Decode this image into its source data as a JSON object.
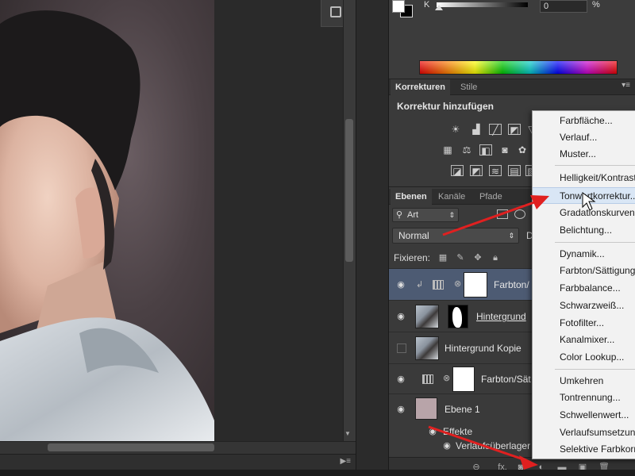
{
  "color_panel": {
    "channel_label": "K",
    "channel_value": "0",
    "percent_sign": "%",
    "foreground_color": "#ffffff",
    "background_color": "#000000"
  },
  "adjustments_panel": {
    "tabs": [
      {
        "label": "Korrekturen",
        "active": true
      },
      {
        "label": "Stile",
        "active": false
      }
    ],
    "title": "Korrektur hinzufügen",
    "icon_rows": [
      [
        "sun-icon",
        "levels-icon",
        "curves-icon",
        "exposure-icon",
        "triangle-icon"
      ],
      [
        "hue-saturation-icon",
        "color-balance-icon",
        "bw-icon",
        "photo-filter-icon",
        "channel-mixer-icon",
        "color-lookup-icon"
      ],
      [
        "invert-icon",
        "posterize-icon",
        "threshold-icon",
        "gradient-map-icon",
        "selective-color-icon"
      ]
    ]
  },
  "layers_panel": {
    "tabs": [
      {
        "label": "Ebenen",
        "active": true
      },
      {
        "label": "Kanäle",
        "active": false
      },
      {
        "label": "Pfade",
        "active": false
      }
    ],
    "filter_value": "Art",
    "blend_mode": "Normal",
    "opacity_label": "D",
    "lock_label": "Fixieren:",
    "layers": [
      {
        "name": "Farbton/",
        "visible": true,
        "selected": true,
        "type": "adjustment"
      },
      {
        "name": "Hintergrund",
        "visible": true,
        "selected": false,
        "type": "photo-mask"
      },
      {
        "name": "Hintergrund Kopie",
        "visible": false,
        "selected": false,
        "type": "photo"
      },
      {
        "name": "Farbton/Sät",
        "visible": true,
        "selected": false,
        "type": "adjustment"
      },
      {
        "name": "Ebene 1",
        "visible": true,
        "selected": false,
        "type": "fill"
      }
    ],
    "effects_label": "Effekte",
    "effect_item": "Verlaufsüberlager",
    "footer_fx": "fx."
  },
  "adjustment_menu": {
    "items": [
      "Farbfläche...",
      "Verlauf...",
      "Muster...",
      "Helligkeit/Kontrast...",
      "Tonwertkorrektur...",
      "Gradationskurven...",
      "Belichtung...",
      "Dynamik...",
      "Farbton/Sättigung...",
      "Farbbalance...",
      "Schwarzweiß...",
      "Fotofilter...",
      "Kanalmixer...",
      "Color Lookup...",
      "Umkehren",
      "Tontrennung...",
      "Schwellenwert...",
      "Verlaufsumsetzung...",
      "Selektive Farbkorrektur..."
    ],
    "highlighted": "Tonwertkorrektur..."
  },
  "colors": {
    "accent_selection": "#4d5b73",
    "arrow": "#e02020"
  }
}
